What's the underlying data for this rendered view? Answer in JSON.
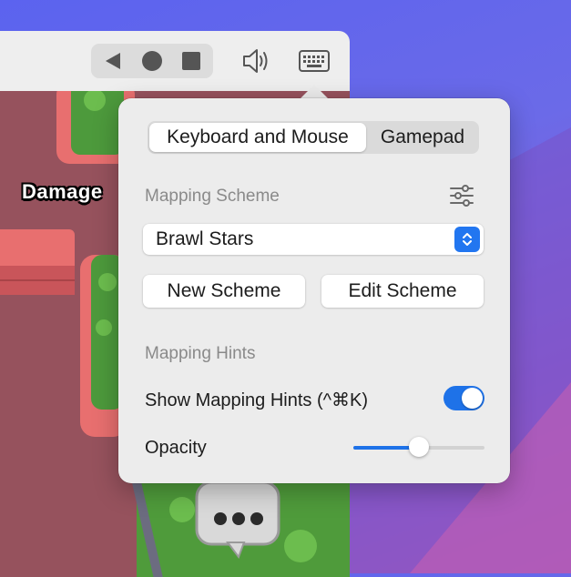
{
  "toolbar": {
    "back_icon": "back-triangle-icon",
    "home_icon": "home-circle-icon",
    "recents_icon": "recents-square-icon",
    "volume_icon": "speaker-icon",
    "keyboard_icon": "keyboard-icon"
  },
  "game": {
    "damage_text": "Damage"
  },
  "popover": {
    "tabs": [
      {
        "label": "Keyboard and Mouse",
        "selected": true
      },
      {
        "label": "Gamepad",
        "selected": false
      }
    ],
    "mapping_scheme": {
      "heading": "Mapping Scheme",
      "settings_icon": "sliders-icon",
      "selected_scheme": "Brawl Stars",
      "new_button": "New Scheme",
      "edit_button": "Edit Scheme"
    },
    "mapping_hints": {
      "heading": "Mapping Hints",
      "show_hints_label": "Show Mapping Hints (^⌘K)",
      "show_hints_on": true,
      "opacity_label": "Opacity",
      "opacity_value": 0.5
    }
  },
  "colors": {
    "accent": "#1e72e8",
    "popover_bg": "#ececec",
    "game_bg": "#9b5660"
  }
}
